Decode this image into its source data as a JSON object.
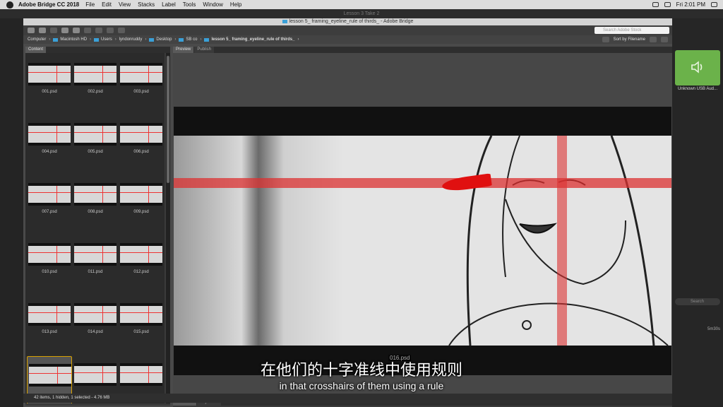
{
  "menubar": {
    "app_name": "Adobe Bridge CC 2018",
    "items": [
      "File",
      "Edit",
      "View",
      "Stacks",
      "Label",
      "Tools",
      "Window",
      "Help"
    ],
    "time": "Fri 2:01 PM"
  },
  "background_window_title": "Lesson 3 Take 2",
  "window": {
    "title": "lesson 5_ framing_eyeline_rule of thirds_ - Adobe Bridge",
    "search_placeholder": "Search Adobe Stock"
  },
  "path": [
    "Computer",
    "Macintosh HD",
    "Users",
    "lyndonruddy",
    "Desktop",
    "SB co",
    "lesson 5_ framing_eyeline_rule of thirds_"
  ],
  "sort_label": "Sort by Filename",
  "content_tab": "Content",
  "preview_tabs": [
    "Preview",
    "Publish"
  ],
  "bottom_tabs": [
    "Metadata",
    "Keywords"
  ],
  "thumbnails": [
    "001.psd",
    "002.psd",
    "003.psd",
    "004.psd",
    "005.psd",
    "006.psd",
    "007.psd",
    "008.psd",
    "009.psd",
    "010.psd",
    "011.psd",
    "012.psd",
    "013.psd",
    "014.psd",
    "015.psd"
  ],
  "selected_file": "016.psd",
  "status": "42 items, 1 hidden, 1 selected - 4.76 MB",
  "right_panel": {
    "audio_label": "Unknown USB Aud...",
    "search_placeholder": "Search",
    "timecode": "5m30s"
  },
  "subtitle": {
    "chinese": "在他们的十字准线中使用规则",
    "english": "in that crosshairs of them using a rule"
  },
  "colors": {
    "accent": "#3aa0d8",
    "selection": "#d9a100",
    "guide_red": "#e03232",
    "audio_green": "#6bb24a"
  }
}
